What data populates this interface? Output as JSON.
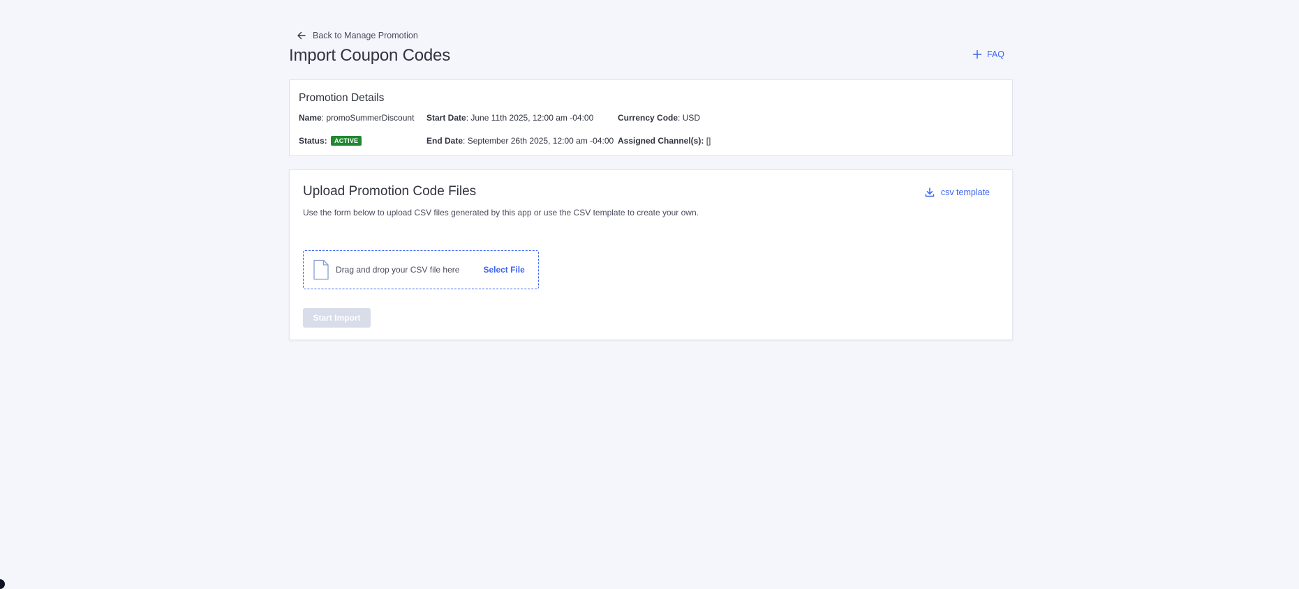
{
  "header": {
    "back_label": "Back to Manage Promotion",
    "title": "Import Coupon Codes",
    "faq_label": "FAQ"
  },
  "details": {
    "title": "Promotion Details",
    "name_label": "Name",
    "name_value": "promoSummerDiscount",
    "status_label": "Status:",
    "status_value": "ACTIVE",
    "start_label": "Start Date",
    "start_value": "June 11th 2025, 12:00 am -04:00",
    "end_label": "End Date",
    "end_value": "September 26th 2025, 12:00 am -04:00",
    "currency_label": "Currency Code",
    "currency_value": "USD",
    "channels_label": "Assigned Channel(s):",
    "channels_value": "[]"
  },
  "upload": {
    "title": "Upload Promotion Code Files",
    "description": "Use the form below to upload CSV files generated by this app or use the CSV template to create your own.",
    "csv_template_label": "csv template",
    "dropzone_text": "Drag and drop your CSV file here",
    "select_file_label": "Select File",
    "start_import_label": "Start Import"
  },
  "colors": {
    "background": "#f4f6fb",
    "primary": "#3c64f4",
    "text": "#313440",
    "active_badge": "#208831",
    "disabled_button": "#d9dce9"
  },
  "icons": {
    "back": "arrow-left-icon",
    "faq": "plus-icon",
    "csv_template": "download-icon",
    "dropzone": "file-icon"
  }
}
